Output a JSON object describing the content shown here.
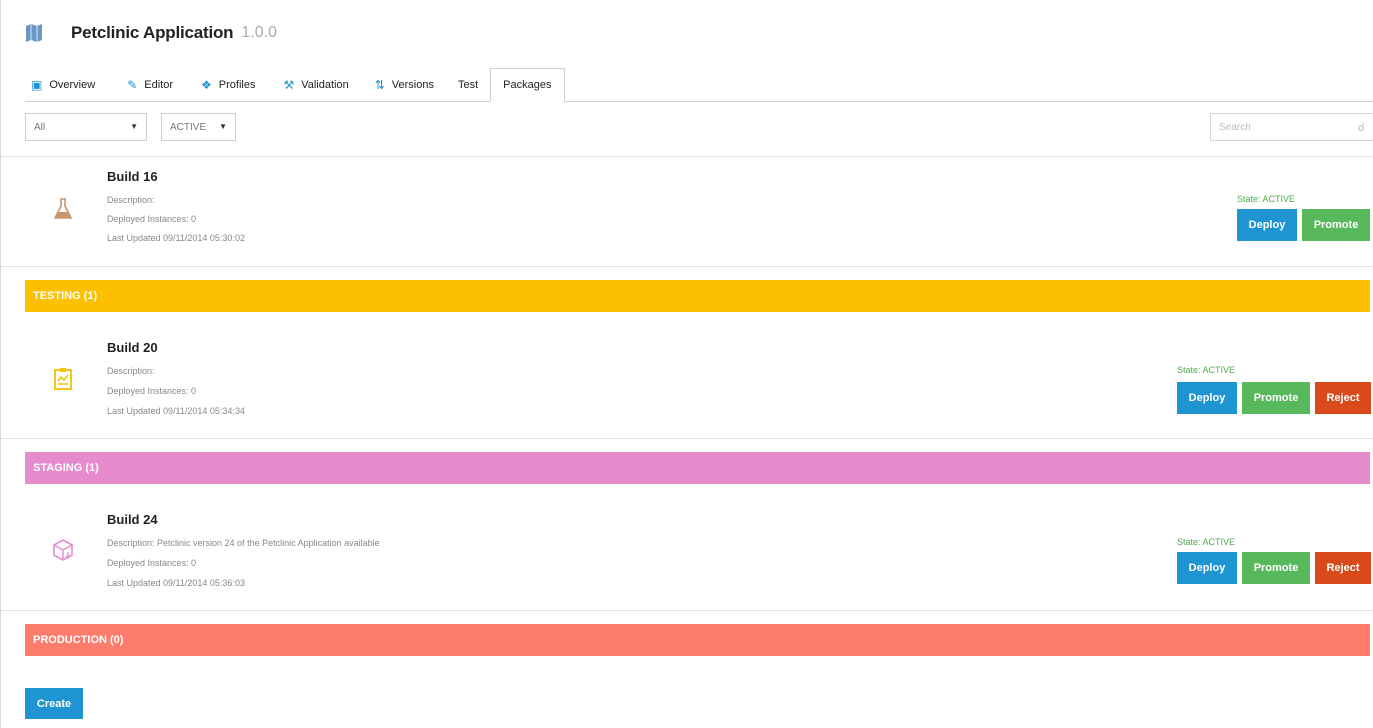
{
  "app": {
    "title": "Petclinic Application",
    "version": "1.0.0",
    "icon": "map-icon"
  },
  "tabs": [
    {
      "label": "Overview",
      "icon": "calendar-icon"
    },
    {
      "label": "Editor",
      "icon": "pencil-icon"
    },
    {
      "label": "Profiles",
      "icon": "profiles-icon"
    },
    {
      "label": "Validation",
      "icon": "gavel-icon"
    },
    {
      "label": "Versions",
      "icon": "versions-icon"
    },
    {
      "label": "Test",
      "icon": ""
    },
    {
      "label": "Packages",
      "icon": "",
      "active": true
    }
  ],
  "filters": {
    "all": "All",
    "state": "ACTIVE",
    "search_placeholder": "Search"
  },
  "builds": [
    {
      "name": "Build 16",
      "description": "Description:",
      "deployed": "Deployed Instances: 0",
      "updated": "Last Updated 09/11/2014 05:30:02",
      "state": "State: ACTIVE",
      "icon": "flask-icon",
      "deploy": "Deploy",
      "promote": "Promote"
    },
    {
      "name": "Build 20",
      "description": "Description:",
      "deployed": "Deployed Instances: 0",
      "updated": "Last Updated 09/11/2014 05:34:34",
      "state": "State: ACTIVE",
      "icon": "clipboard-icon",
      "deploy": "Deploy",
      "promote": "Promote",
      "reject": "Reject"
    },
    {
      "name": "Build 24",
      "description": "Description: Petclinic version 24 of the Petclinic Application available",
      "deployed": "Deployed Instances: 0",
      "updated": "Last Updated 09/11/2014 05:36:03",
      "state": "State: ACTIVE",
      "icon": "package-icon",
      "deploy": "Deploy",
      "promote": "Promote",
      "reject": "Reject"
    }
  ],
  "stages": {
    "testing": "TESTING (1)",
    "staging": "STAGING (1)",
    "production": "PRODUCTION (0)"
  },
  "colors": {
    "testing": "#fcc000",
    "staging": "#e68ccd",
    "production": "#fd7c6b",
    "deploy": "#1e94d2",
    "promote": "#58b85c",
    "reject": "#d94a1a"
  },
  "create_label": "Create"
}
